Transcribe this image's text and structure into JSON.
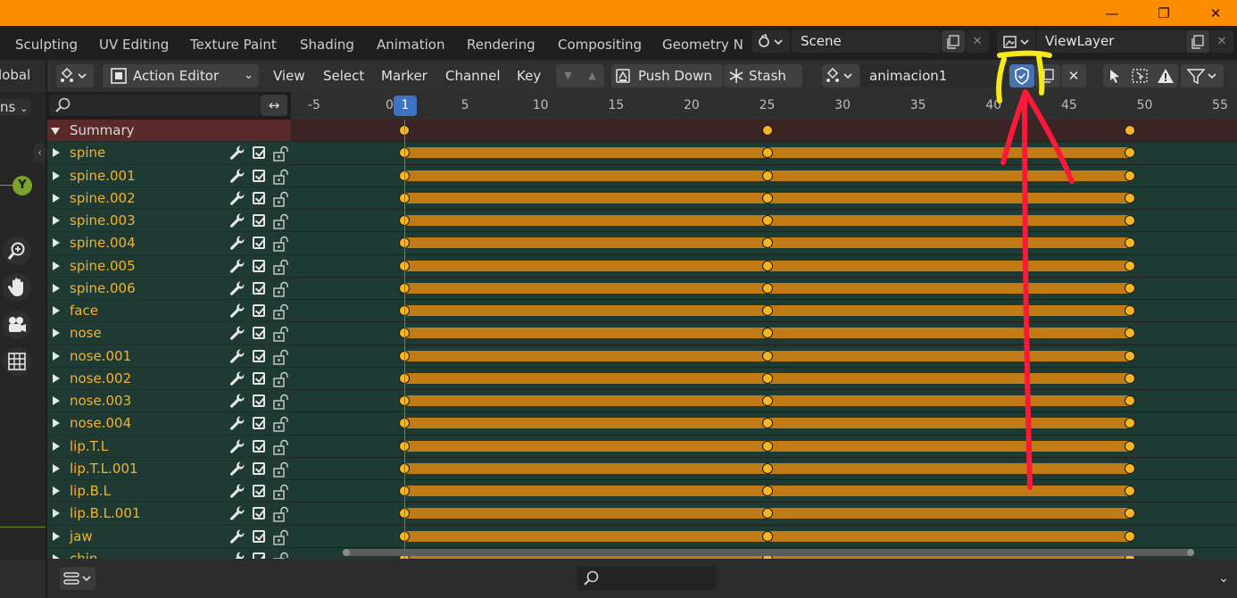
{
  "window": {
    "minimize": "—",
    "maximize": "❐",
    "close": "✕"
  },
  "workspaces": {
    "tabs": [
      "Sculpting",
      "UV Editing",
      "Texture Paint",
      "Shading",
      "Animation",
      "Rendering",
      "Compositing",
      "Geometry No"
    ],
    "scene": "Scene",
    "view_layer": "ViewLayer"
  },
  "left_strip": {
    "header_text": "lobal",
    "mode_text": "ns",
    "axis_label": "Y"
  },
  "editor_header": {
    "editor_type": "Action Editor",
    "menus": [
      "View",
      "Select",
      "Marker",
      "Channel",
      "Key"
    ],
    "push_down": "Push Down",
    "stash": "Stash",
    "action_name": "animacion1"
  },
  "timeline": {
    "ticks": [
      "-5",
      "0",
      "5",
      "10",
      "15",
      "20",
      "25",
      "30",
      "35",
      "40",
      "45",
      "50",
      "55"
    ],
    "current_frame": "1",
    "keyframes": [
      1,
      25,
      49
    ]
  },
  "channels": [
    "Summary",
    "spine",
    "spine.001",
    "spine.002",
    "spine.003",
    "spine.004",
    "spine.005",
    "spine.006",
    "face",
    "nose",
    "nose.001",
    "nose.002",
    "nose.003",
    "nose.004",
    "lip.T.L",
    "lip.T.L.001",
    "lip.B.L",
    "lip.B.L.001",
    "jaw",
    "chin"
  ],
  "colors": {
    "title_bar": "#fd8d00",
    "channel_text": "#f2b330",
    "keyframe": "#f6b61e",
    "hold_bar": "#c17b15",
    "playhead": "#3c73c4",
    "annotation_arrow": "#ff1838",
    "annotation_highlight": "#f7e818"
  },
  "icons": {
    "wrench": "wrench-icon",
    "checkbox": "checkbox-icon",
    "lock": "lock-icon",
    "shield": "fake-user-shield-icon",
    "search": "search-icon",
    "filter": "filter-icon"
  }
}
